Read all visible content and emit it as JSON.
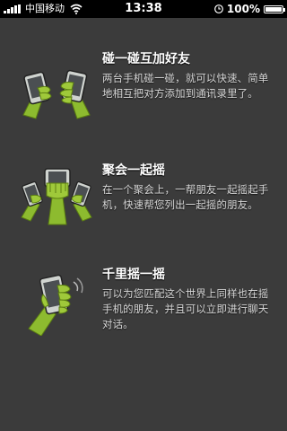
{
  "status_bar": {
    "carrier": "中国移动",
    "time": "13:38",
    "battery": "100%",
    "battery_level": 1.0
  },
  "features": [
    {
      "icon": "phones-bump-icon",
      "title": "碰一碰互加好友",
      "description": "两台手机碰一碰，就可以快速、简单地相互把对方添加到通讯录里了。"
    },
    {
      "icon": "group-shake-icon",
      "title": "聚会一起摇",
      "description": "在一个聚会上，一帮朋友一起摇起手机，快速帮您列出一起摇的朋友。"
    },
    {
      "icon": "hand-shake-phone-icon",
      "title": "千里摇一摇",
      "description": "可以为您匹配这个世界上同样也在摇手机的朋友，并且可以立即进行聊天对话。"
    }
  ]
}
